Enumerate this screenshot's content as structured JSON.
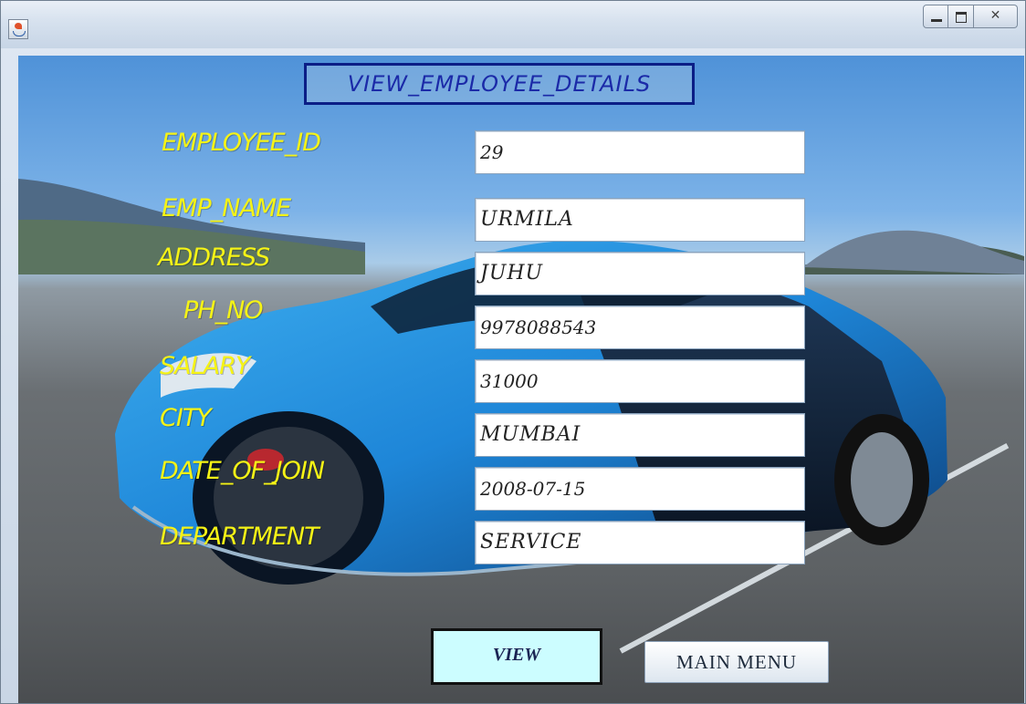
{
  "window": {
    "title": ""
  },
  "form": {
    "heading": "VIEW_EMPLOYEE_DETAILS",
    "fields": [
      {
        "label": "EMPLOYEE_ID",
        "value": "29"
      },
      {
        "label": "EMP_NAME",
        "value": "URMILA"
      },
      {
        "label": "ADDRESS",
        "value": "JUHU"
      },
      {
        "label": "PH_NO",
        "value": "9978088543"
      },
      {
        "label": "SALARY",
        "value": "31000"
      },
      {
        "label": "CITY",
        "value": "MUMBAI"
      },
      {
        "label": "DATE_OF_JOIN",
        "value": "2008-07-15"
      },
      {
        "label": "DEPARTMENT",
        "value": "SERVICE"
      }
    ]
  },
  "buttons": {
    "view": "VIEW",
    "main_menu": "MAIN MENU"
  },
  "colors": {
    "label": "#f5f316",
    "heading": "#1b2aa8",
    "view_button_bg": "#ccfdff",
    "car_body": "#1e86d8"
  },
  "icons": {
    "app": "java-cup-icon",
    "minimize": "minimize-icon",
    "maximize": "maximize-icon",
    "close": "close-icon"
  }
}
